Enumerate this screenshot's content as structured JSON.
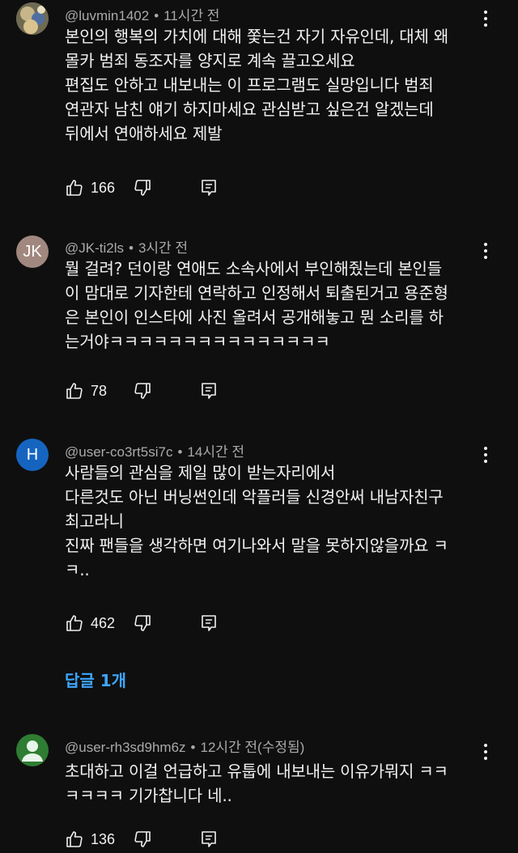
{
  "comments": [
    {
      "author": "@luvmin1402",
      "time": "11시간 전",
      "lines": [
        "본인의 행복의 가치에 대해 쫓는건 자기 자유인데, 대체 왜",
        "몰카 범죄 동조자를 양지로 계속 끌고오세요",
        "편집도 안하고 내보내는 이 프로그램도 실망입니다 범죄",
        "연관자 남친 얘기 하지마세요 관심받고 싶은건 알겠는데",
        "뒤에서 연애하세요 제발"
      ],
      "likes": "166"
    },
    {
      "author": "@JK-ti2ls",
      "time": "3시간 전",
      "avatar_text": "JK",
      "lines": [
        "뭘 걸려? 던이랑 연애도 소속사에서 부인해줬는데 본인들",
        "이 맘대로 기자한테 연락하고 인정해서 퇴출된거고 용준형",
        "은 본인이 인스타에 사진 올려서 공개해놓고 뭔 소리를 하",
        "는거야ㅋㅋㅋㅋㅋㅋㅋㅋㅋㅋㅋㅋㅋㅋㅋ"
      ],
      "likes": "78"
    },
    {
      "author": "@user-co3rt5si7c",
      "time": "14시간 전",
      "avatar_text": "H",
      "lines": [
        "사람들의 관심을 제일 많이 받는자리에서",
        "다른것도 아닌 버닝썬인데 악플러들 신경안써 내남자친구",
        "최고라니",
        "진짜 팬들을 생각하면 여기나와서 말을 못하지않을까요 ㅋ",
        "ㅋ.."
      ],
      "likes": "462",
      "replies_label": "답글 1개"
    },
    {
      "author": "@user-rh3sd9hm6z",
      "time": "12시간 전(수정됨)",
      "lines": [
        "초대하고 이걸 언급하고 유툽에 내보내는 이유가뭐지 ㅋㅋ",
        "ㅋㅋㅋㅋ 기가찹니다 네.."
      ],
      "likes": "136"
    }
  ],
  "colors": {
    "background": "#0f0f0f",
    "text": "#f1f1f1",
    "meta": "#aaaaaa",
    "link": "#3ea6ff",
    "avatar_jk": "#a1887f",
    "avatar_h": "#1565c0",
    "avatar_default": "#2e7d32"
  }
}
